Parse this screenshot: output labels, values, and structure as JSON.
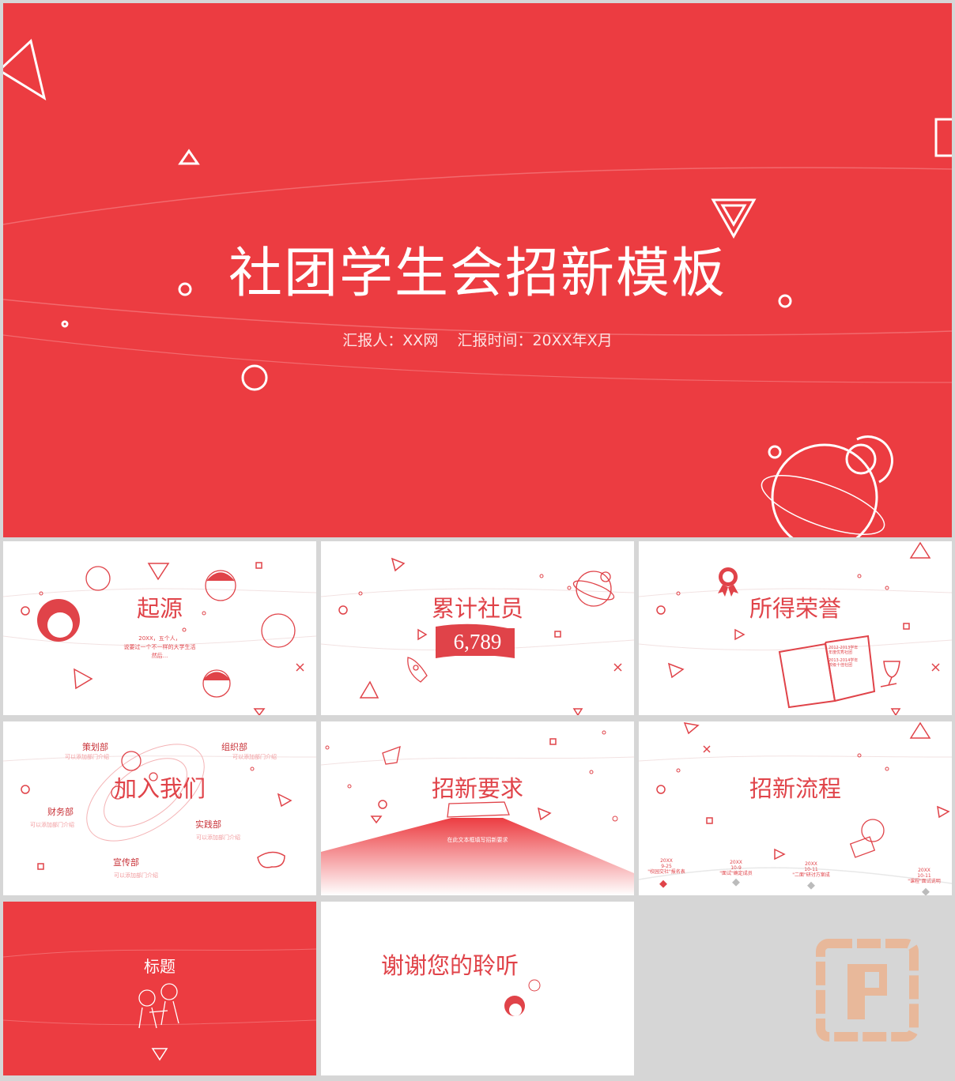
{
  "colors": {
    "brand_red": "#ec3c41",
    "text_red": "#e04349",
    "gray_bg": "#d6d6d6"
  },
  "cover": {
    "title": "社团学生会招新模板",
    "subtitle": "汇报人：XX网    汇报时间：20XX年X月"
  },
  "slides": {
    "origin": {
      "title": "起源",
      "text_lines": [
        "20XX，五个人，",
        "说要过一个不一样的大学生活",
        "然后..."
      ]
    },
    "members": {
      "title": "累计社员",
      "count": "6,789"
    },
    "honors": {
      "title": "所得荣誉",
      "notes": [
        "2012-2013学年",
        "年度优秀社团",
        "2013-2014学年",
        "校级十佳社团"
      ]
    },
    "join": {
      "title": "加入我们",
      "departments": [
        {
          "name": "策划部",
          "desc": "可以添加部门介绍"
        },
        {
          "name": "组织部",
          "desc": "可以添加部门介绍"
        },
        {
          "name": "财务部",
          "desc": "可以添加部门介绍"
        },
        {
          "name": "实践部",
          "desc": "可以添加部门介绍"
        },
        {
          "name": "宣传部",
          "desc": "可以添加部门介绍"
        }
      ]
    },
    "requirements": {
      "title": "招新要求",
      "body": "在此文本框填写招新要求"
    },
    "process": {
      "title": "招新流程",
      "timeline": [
        {
          "date": "20XX\n9-25",
          "text": "\"校园交社\"报名表"
        },
        {
          "date": "20XX\n10-9",
          "text": "\"面试\"确定成员"
        },
        {
          "date": "20XX\n10-11",
          "text": "\"二面\"研讨方案成"
        },
        {
          "date": "20XX\n10-11",
          "text": "\"课程\"面试说明"
        }
      ]
    },
    "section": {
      "title": "标题"
    },
    "thanks": {
      "title": "谢谢您的聆听"
    }
  },
  "icons": [
    "triangle-icon",
    "circle-icon",
    "square-icon",
    "cross-icon",
    "planet-icon",
    "rocket-icon",
    "medal-icon",
    "trophy-icon",
    "notebook-icon",
    "gamepad-icon",
    "keyboard-icon",
    "avatar-icon",
    "watermark-logo"
  ]
}
